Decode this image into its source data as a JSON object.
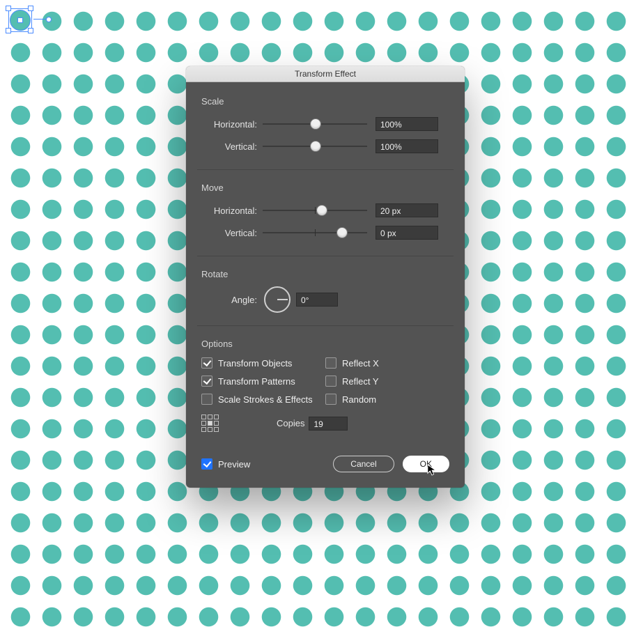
{
  "dialog": {
    "title": "Transform Effect",
    "scale": {
      "label": "Scale",
      "horizontal_label": "Horizontal:",
      "horizontal_value": "100%",
      "vertical_label": "Vertical:",
      "vertical_value": "100%"
    },
    "move": {
      "label": "Move",
      "horizontal_label": "Horizontal:",
      "horizontal_value": "20 px",
      "vertical_label": "Vertical:",
      "vertical_value": "0 px"
    },
    "rotate": {
      "label": "Rotate",
      "angle_label": "Angle:",
      "angle_value": "0°"
    },
    "options": {
      "label": "Options",
      "transform_objects": "Transform Objects",
      "transform_patterns": "Transform Patterns",
      "scale_strokes": "Scale Strokes & Effects",
      "reflect_x": "Reflect X",
      "reflect_y": "Reflect Y",
      "random": "Random"
    },
    "copies": {
      "label": "Copies",
      "value": "19"
    },
    "preview_label": "Preview",
    "cancel_label": "Cancel",
    "ok_label": "OK"
  }
}
